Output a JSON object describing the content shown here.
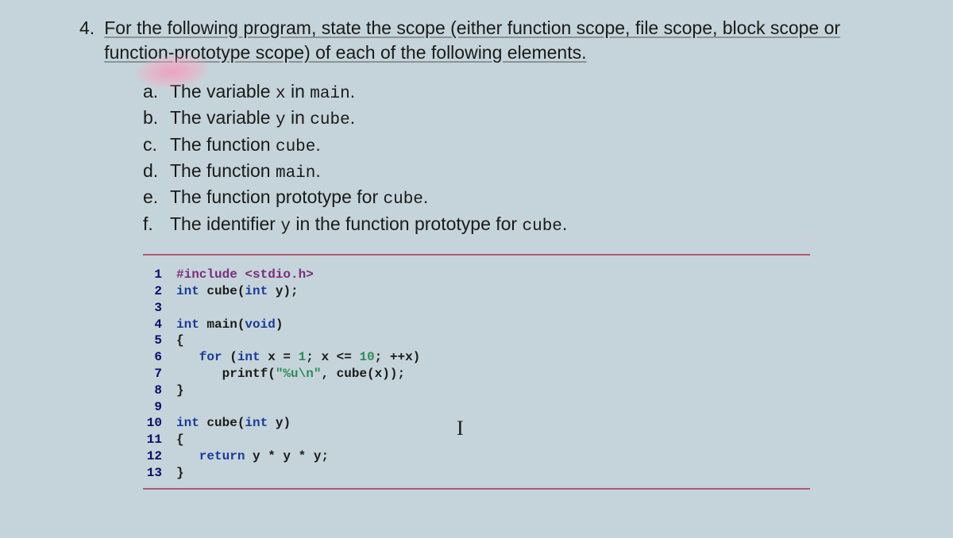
{
  "question": {
    "number": "4.",
    "text": "For the following program, state the scope (either function scope, file scope, block scope or function-prototype scope) of each of the following elements."
  },
  "subitems": {
    "a": {
      "letter": "a.",
      "pre": "The variable ",
      "code": "x",
      "mid": " in ",
      "code2": "main",
      "post": "."
    },
    "b": {
      "letter": "b.",
      "pre": "The variable ",
      "code": "y",
      "mid": " in ",
      "code2": "cube",
      "post": "."
    },
    "c": {
      "letter": "c.",
      "pre": "The function ",
      "code": "cube",
      "post": "."
    },
    "d": {
      "letter": "d.",
      "pre": "The function ",
      "code": "main",
      "post": "."
    },
    "e": {
      "letter": "e.",
      "pre": "The function prototype for ",
      "code": "cube",
      "post": "."
    },
    "f": {
      "letter": "f.",
      "pre": "The identifier ",
      "code": "y",
      "mid": " in the function prototype for ",
      "code2": "cube",
      "post": "."
    }
  },
  "code": {
    "l1n": "1",
    "l1a": "#include <stdio.h>",
    "l2n": "2",
    "l2a": "int",
    "l2b": " cube(",
    "l2c": "int",
    "l2d": " y);",
    "l3n": "3",
    "l4n": "4",
    "l4a": "int",
    "l4b": " main(",
    "l4c": "void",
    "l4d": ")",
    "l5n": "5",
    "l5a": "{",
    "l6n": "6",
    "l6a": "   for",
    "l6b": " (",
    "l6c": "int",
    "l6d": " x = ",
    "l6e": "1",
    "l6f": "; x <= ",
    "l6g": "10",
    "l6h": "; ++x)",
    "l7n": "7",
    "l7a": "      printf(",
    "l7b": "\"%u\\n\"",
    "l7c": ", cube(x));",
    "l8n": "8",
    "l8a": "}",
    "l9n": "9",
    "l10n": "10",
    "l10a": "int",
    "l10b": " cube(",
    "l10c": "int",
    "l10d": " y)",
    "l11n": "11",
    "l11a": "{",
    "l12n": "12",
    "l12a": "   return",
    "l12b": " y * y * y;",
    "l13n": "13",
    "l13a": "}"
  },
  "cursor_glyph": "I"
}
